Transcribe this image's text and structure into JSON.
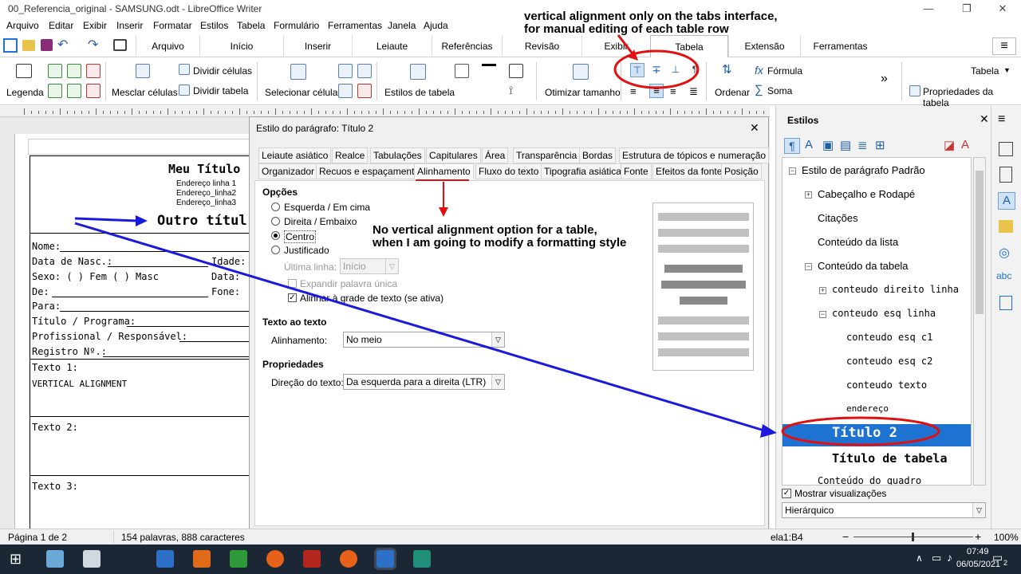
{
  "window": {
    "title": "00_Referencia_original - SAMSUNG.odt - LibreOffice Writer",
    "min": "—",
    "max": "❐",
    "close": "✕"
  },
  "menu": [
    "Arquivo",
    "Editar",
    "Exibir",
    "Inserir",
    "Formatar",
    "Estilos",
    "Tabela",
    "Formulário",
    "Ferramentas",
    "Janela",
    "Ajuda"
  ],
  "tabs": [
    "Arquivo",
    "Início",
    "Inserir",
    "Leiaute",
    "Referências",
    "Revisão",
    "Exibir",
    "Tabela",
    "Extensão",
    "Ferramentas"
  ],
  "active_tab": "Tabela",
  "toolbar": {
    "legenda": "Legenda",
    "dividir_celulas": "Dividir células",
    "mesclar_celulas": "Mesclar células",
    "dividir_tabela": "Dividir tabela",
    "selecionar_celula": "Selecionar célula",
    "estilos_de_tabela": "Estilos de tabela",
    "otimizar_tamanho": "Otimizar tamanho",
    "ordenar": "Ordenar",
    "formula": "Fórmula",
    "soma": "Soma",
    "tabela": "Tabela",
    "propriedades": "Propriedades da tabela",
    "more": "»"
  },
  "document": {
    "heading": "Meu Título",
    "address": [
      "Endereço linha 1",
      "Endereço_linha2",
      "Endereço_linha3"
    ],
    "outro": "Outro títul",
    "fields": [
      "Nome:",
      "Data de Nasc.:",
      "Sexo: ( ) Fem  ( ) Masc",
      "De:",
      "Para:",
      "Título / Programa:",
      "Profissional / Responsável:",
      "Registro Nº.:",
      "Texto 1:",
      "VERTICAL ALIGNMENT",
      "Texto 2:",
      "Texto 3:"
    ],
    "right_fields": [
      "Idade:",
      "Data:",
      "Fone:"
    ]
  },
  "dialog": {
    "title": "Estilo do parágrafo: Título 2",
    "close": "✕",
    "tabs_row1": [
      "Leiaute asiático",
      "Realce",
      "Tabulações",
      "Capitulares",
      "Área",
      "Transparência",
      "Bordas",
      "Estrutura de tópicos e numeração"
    ],
    "tabs_row2": [
      "Organizador",
      "Recuos e espaçamento",
      "Alinhamento",
      "Fluxo do texto",
      "Tipografia asiática",
      "Fonte",
      "Efeitos da fonte",
      "Posição"
    ],
    "selected_tab": "Alinhamento",
    "opcoes": "Opções",
    "radios": [
      "Esquerda / Em cima",
      "Direita / Embaixo",
      "Centro",
      "Justificado"
    ],
    "selected_radio": "Centro",
    "ultima_linha": "Última linha:",
    "ultima_linha_value": "Início",
    "expandir": "Expandir palavra única",
    "alinhar": "Alinhar à grade de texto (se ativa)",
    "texto_ao_texto": "Texto ao texto",
    "alinhamento_label": "Alinhamento:",
    "alinhamento_value": "No meio",
    "propriedades": "Propriedades",
    "direcao_label": "Direção do texto:",
    "direcao_value": "Da esquerda para a direita (LTR)"
  },
  "sidebar": {
    "title": "Estilos",
    "tree": [
      {
        "label": "Estilo de parágrafo Padrão",
        "level": 0,
        "expander": "−"
      },
      {
        "label": "Cabeçalho e Rodapé",
        "level": 1,
        "expander": "+"
      },
      {
        "label": "Citações",
        "level": 1,
        "expander": ""
      },
      {
        "label": "Conteúdo da lista",
        "level": 1,
        "expander": ""
      },
      {
        "label": "Conteúdo da tabela",
        "level": 1,
        "expander": "−"
      },
      {
        "label": "conteudo direito linha",
        "level": 2,
        "expander": "+"
      },
      {
        "label": "conteudo esq linha",
        "level": 2,
        "expander": "−"
      },
      {
        "label": "conteudo esq c1",
        "level": 3,
        "expander": ""
      },
      {
        "label": "conteudo esq c2",
        "level": 3,
        "expander": ""
      },
      {
        "label": "conteudo texto",
        "level": 3,
        "expander": ""
      },
      {
        "label": "endereço",
        "level": 3,
        "expander": ""
      },
      {
        "label": "Título 2",
        "level": 2,
        "expander": ""
      },
      {
        "label": "Título de tabela",
        "level": 2,
        "expander": ""
      },
      {
        "label": "Conteúdo do quadro",
        "level": 1,
        "expander": ""
      }
    ],
    "selected": "Título 2",
    "mostrar": "Mostrar visualizações",
    "filter": "Hierárquico"
  },
  "status": {
    "page": "Página 1 de 2",
    "words": "154 palavras, 888 caracteres",
    "cell": "ela1:B4",
    "zoom": "100%"
  },
  "taskbar": {
    "time": "07:49",
    "date": "06/05/2021",
    "notif": "2"
  },
  "annotations": {
    "top": "vertical alignment only on the tabs interface,",
    "top2": "for manual editing of each table row",
    "mid": "No vertical alignment option for a table,",
    "mid2": "when I am going to modify a formatting style"
  },
  "colors": {
    "accent": "#1e73d2",
    "arrow_blue": "#1a1adf",
    "annot_red": "#e01010",
    "taskbar": "#1b2735"
  }
}
